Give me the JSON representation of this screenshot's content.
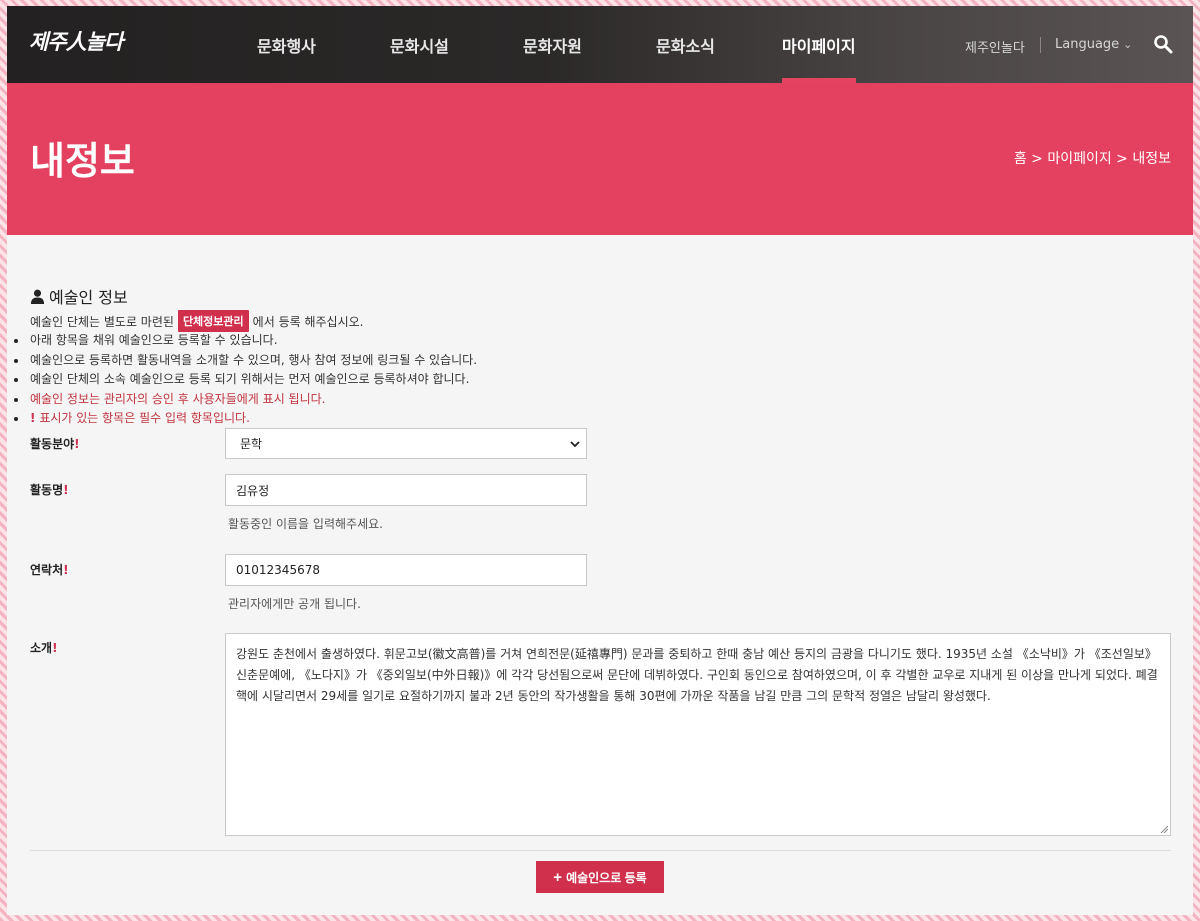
{
  "header": {
    "logo": "제주人놀다",
    "nav": [
      {
        "label": "문화행사",
        "active": false
      },
      {
        "label": "문화시설",
        "active": false
      },
      {
        "label": "문화자원",
        "active": false
      },
      {
        "label": "문화소식",
        "active": false
      },
      {
        "label": "마이페이지",
        "active": true
      }
    ],
    "site_link": "제주인놀다",
    "language": "Language"
  },
  "hero": {
    "title": "내정보",
    "breadcrumb": "홈 > 마이페이지 > 내정보"
  },
  "section": {
    "title": "예술인 정보",
    "intro_before": "예술인 단체는 별도로 마련된",
    "intro_badge": "단체정보관리",
    "intro_after": "에서 등록 해주십시오.",
    "bullets": [
      "아래 항목을 채워 예술인으로 등록할 수 있습니다.",
      "예술인으로 등록하면 활동내역을 소개할 수 있으며, 행사 참여 정보에 링크될 수 있습니다.",
      "예술인 단체의 소속 예술인으로 등록 되기 위해서는 먼저 예술인으로 등록하셔야 합니다.",
      "예술인 정보는 관리자의 승인 후 사용자들에게 표시 됩니다."
    ],
    "required_note": "표시가 있는 항목은 필수 입력 항목입니다.",
    "required_mark": "!"
  },
  "form": {
    "field_label": "활동분야",
    "field_value": "문학",
    "name_label": "활동명",
    "name_value": "김유정",
    "name_help": "활동중인 이름을 입력해주세요.",
    "contact_label": "연락처",
    "contact_value": "01012345678",
    "contact_help": "관리자에게만 공개 됩니다.",
    "intro_label": "소개",
    "intro_value": "강원도 춘천에서 출생하였다. 휘문고보(徽文高普)를 거쳐 연희전문(延禧專門) 문과를 중퇴하고 한때 충남 예산 등지의 금광을 다니기도 했다. 1935년 소설 《소낙비》가 《조선일보》 신춘문예에, 《노다지》가 《중외일보(中外日報)》에 각각 당선됨으로써 문단에 데뷔하였다. 구인회 동인으로 참여하였으며, 이 후 각별한 교우로 지내게 된 이상을 만나게 되었다. 폐결핵에 시달리면서 29세를 일기로 요절하기까지 불과 2년 동안의 작가생활을 통해 30편에 가까운 작품을 남길 만큼 그의 문학적 정열은 남달리 왕성했다.",
    "submit_label": "예술인으로 등록",
    "submit_icon": "+"
  },
  "colors": {
    "brand": "#e3415f",
    "accent": "#d1304d"
  }
}
